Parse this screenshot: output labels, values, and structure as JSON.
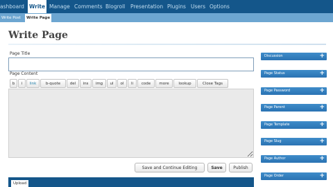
{
  "topnav": {
    "items": [
      "ashboard",
      "Write",
      "Manage",
      "Comments",
      "Blogroll",
      "Presentation",
      "Plugins",
      "Users",
      "Options"
    ]
  },
  "subnav": {
    "items": [
      "Write Post",
      "Write Page"
    ]
  },
  "page": {
    "title": "Write Page",
    "title_label": "Page Title",
    "title_value": "",
    "content_label": "Page Content"
  },
  "toolbar": {
    "buttons": [
      "b",
      "i",
      "link",
      "b-quote",
      "del",
      "ins",
      "img",
      "ul",
      "ol",
      "li",
      "code",
      "more",
      "lookup",
      "Close Tags"
    ]
  },
  "actions": {
    "save_continue": "Save and Continue Editing",
    "save": "Save",
    "publish": "Publish"
  },
  "upload": {
    "tab_label": "Upload"
  },
  "sidebar": {
    "toggle_symbol": "+",
    "boxes": [
      "Discussion",
      "Page Status",
      "Page Password",
      "Page Parent",
      "Page Template",
      "Page Slug",
      "Page Author",
      "Page Order"
    ]
  },
  "colors": {
    "nav_dark_blue": "#14568a",
    "subnav_blue": "#6da6d1",
    "sidebar_box_blue": "#2f7bbd"
  }
}
